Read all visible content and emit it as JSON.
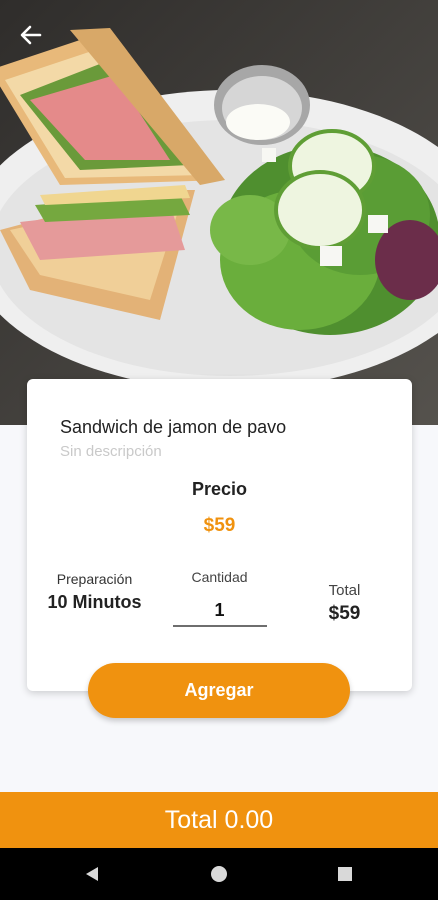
{
  "header": {
    "back_icon": "arrow-left-icon"
  },
  "hero": {
    "image_description": "photo of ham and turkey sandwich with green salad, cucumber slices and dressing cup on a white plate"
  },
  "product": {
    "name": "Sandwich de jamon de pavo",
    "description": "Sin descripción",
    "price_label": "Precio",
    "price": "$59"
  },
  "details": {
    "prep_label": "Preparación",
    "prep_value": "10 Minutos",
    "quantity_label": "Cantidad",
    "quantity_value": "1",
    "total_label": "Total",
    "total_value": "$59"
  },
  "actions": {
    "add_label": "Agregar"
  },
  "footer": {
    "total_text": "Total 0.00"
  },
  "nav": {
    "back_icon": "triangle-back-icon",
    "home_icon": "circle-home-icon",
    "recents_icon": "square-recents-icon"
  },
  "colors": {
    "accent": "#f0920f",
    "background": "#f7f8fb",
    "card": "#ffffff"
  }
}
